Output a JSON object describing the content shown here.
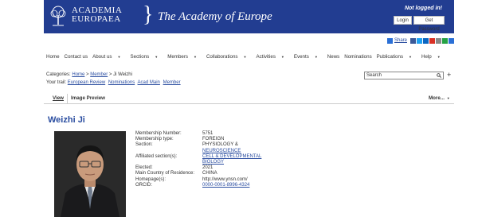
{
  "header": {
    "logo_line1": "ACADEMIA",
    "logo_line2": "EUROPAEA",
    "tagline": "The Academy of Europe",
    "not_logged_in": "Not logged in!",
    "login_label": "Login",
    "password_label": "Get Password",
    "bg_color": "#223d91"
  },
  "share": {
    "label": "Share"
  },
  "nav": {
    "items": [
      {
        "label": "Home"
      },
      {
        "label": "Contact us"
      },
      {
        "label": "About us"
      },
      {
        "label": "Sections"
      },
      {
        "label": "Members"
      },
      {
        "label": "Collaborations"
      },
      {
        "label": "Activities"
      },
      {
        "label": "Events"
      },
      {
        "label": "News"
      },
      {
        "label": "Nominations"
      },
      {
        "label": "Publications"
      },
      {
        "label": "Help"
      }
    ]
  },
  "breadcrumb": {
    "prefix": "Categories:",
    "home": "Home",
    "sep1": " > ",
    "member": "Member",
    "sep2": " > ",
    "current": "Ji Weizhi"
  },
  "visit": {
    "prefix": "Your trail:",
    "links": [
      "European Review",
      "Nominations",
      "Acad Main",
      "Member"
    ]
  },
  "search": {
    "placeholder": "Search"
  },
  "tabs": {
    "view": "View",
    "preview": "Image Preview",
    "more": "More..."
  },
  "person": {
    "name": "Weizhi Ji",
    "fields": [
      {
        "label": "Membership Number:",
        "value": "5751"
      },
      {
        "label": "Membership type:",
        "value": "FOREIGN"
      },
      {
        "label": "Section:",
        "value": "PHYSIOLOGY &",
        "value2": "NEUROSCIENCE"
      },
      {
        "label": "Affiliated section(s):",
        "value": "CELL & DEVELOPMENTAL",
        "value2": "BIOLOGY"
      },
      {
        "label": "Elected:",
        "value": "2021"
      },
      {
        "label": "Main Country of Residence:",
        "value": "CHINA"
      },
      {
        "label": "Homepage(s):",
        "value": "http://www.ynsn.com/"
      },
      {
        "label": "ORCID:",
        "value": "0000-0001-8996-4324"
      }
    ]
  }
}
